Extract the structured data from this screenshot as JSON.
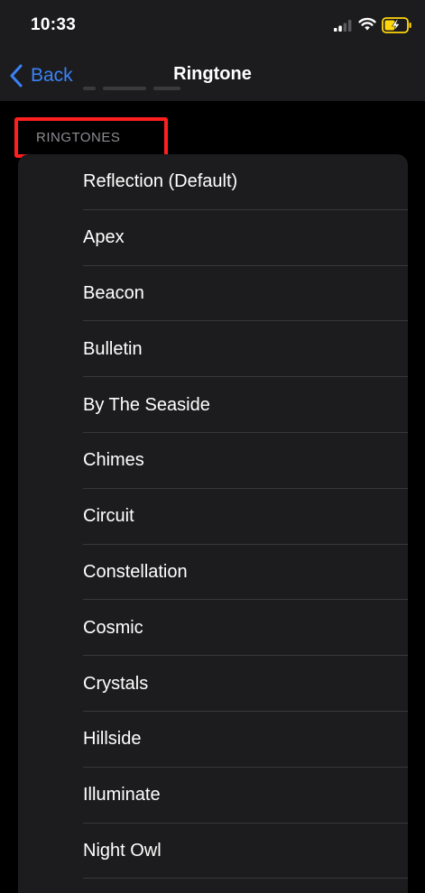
{
  "status_bar": {
    "time": "10:33",
    "icons": [
      "signal-icon",
      "wifi-icon",
      "battery-charging-icon"
    ]
  },
  "nav": {
    "back_label": "Back",
    "title": "Ringtone"
  },
  "section": {
    "header": "RINGTONES"
  },
  "ringtones": [
    {
      "label": "Reflection (Default)"
    },
    {
      "label": "Apex"
    },
    {
      "label": "Beacon"
    },
    {
      "label": "Bulletin"
    },
    {
      "label": "By The Seaside"
    },
    {
      "label": "Chimes"
    },
    {
      "label": "Circuit"
    },
    {
      "label": "Constellation"
    },
    {
      "label": "Cosmic"
    },
    {
      "label": "Crystals"
    },
    {
      "label": "Hillside"
    },
    {
      "label": "Illuminate"
    },
    {
      "label": "Night Owl"
    }
  ],
  "colors": {
    "accent": "#3a82f7",
    "highlight": "#ff1f1f",
    "background": "#000000",
    "card": "#1c1c1e",
    "battery_fill": "#ffd60a"
  }
}
